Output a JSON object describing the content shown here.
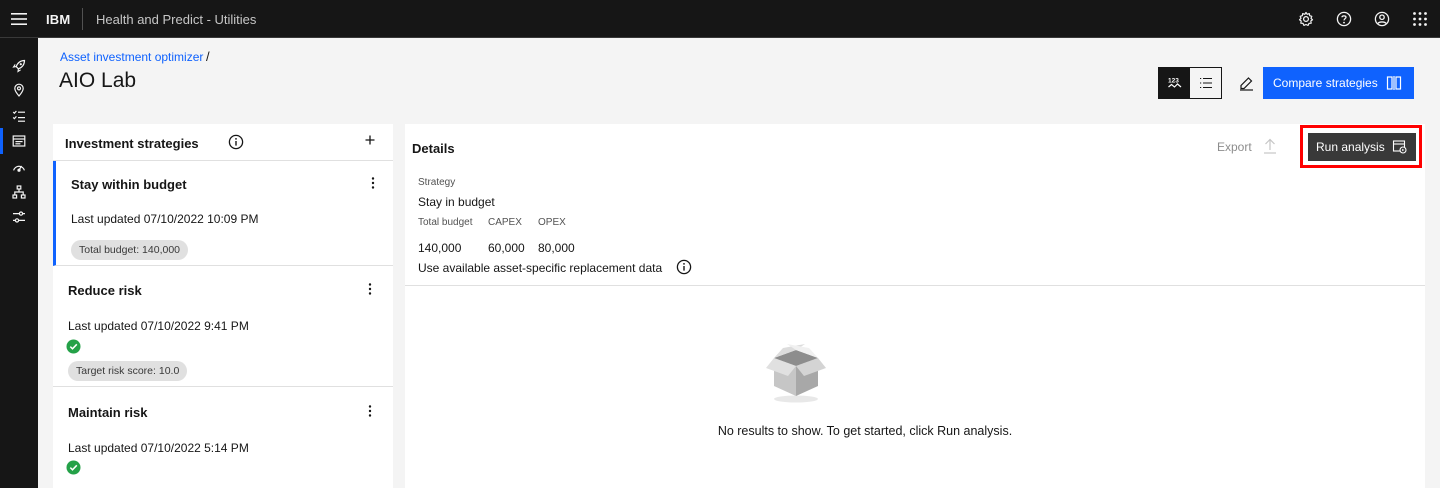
{
  "header": {
    "brand": "IBM",
    "product": "Health and Predict - Utilities"
  },
  "page": {
    "breadcrumb": "Asset investment optimizer",
    "breadcrumb_separator": "/",
    "title": "AIO Lab",
    "compare_label": "Compare strategies"
  },
  "strategies": {
    "title": "Investment strategies",
    "cards": [
      {
        "name": "Stay within budget",
        "updated": "Last updated 07/10/2022 10:09 PM",
        "tag": "Total budget: 140,000"
      },
      {
        "name": "Reduce risk",
        "updated": "Last updated 07/10/2022 9:41 PM",
        "tag": "Target risk score: 10.0"
      },
      {
        "name": "Maintain risk",
        "updated": "Last updated 07/10/2022 5:14 PM"
      }
    ]
  },
  "details": {
    "title": "Details",
    "export_label": "Export",
    "run_label": "Run analysis",
    "strategy_label": "Strategy",
    "strategy_value": "Stay in budget",
    "total_budget_label": "Total budget",
    "capex_label": "CAPEX",
    "opex_label": "OPEX",
    "total_budget_value": "140,000",
    "capex_value": "60,000",
    "opex_value": "80,000",
    "replacement_note": "Use available asset-specific replacement data",
    "empty_message": "No results to show. To get started, click Run analysis."
  },
  "colors": {
    "accent": "#0f62fe",
    "highlight": "#ff0000",
    "success": "#24a148",
    "shell": "#161616"
  },
  "icons": {
    "header": [
      "menu-icon",
      "settings-icon",
      "help-icon",
      "user-icon",
      "app-switcher-icon"
    ],
    "rail": [
      "rocket-icon",
      "location-icon",
      "checklist-icon",
      "dashboard-icon",
      "meter-icon",
      "hierarchy-icon",
      "sliders-icon"
    ]
  }
}
